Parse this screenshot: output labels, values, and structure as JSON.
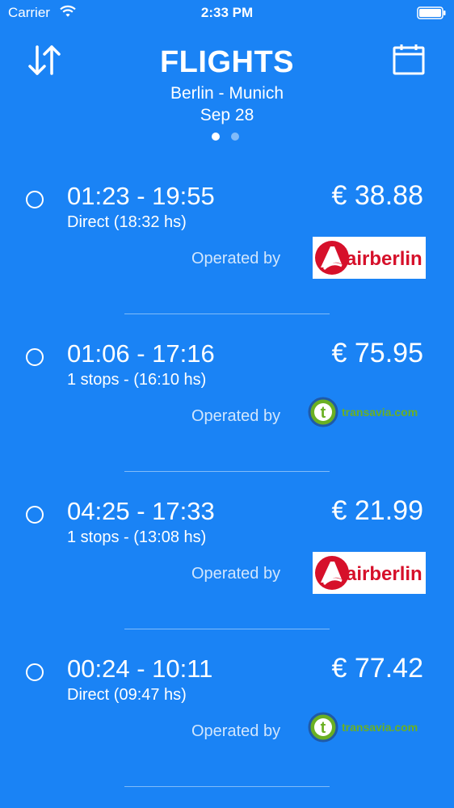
{
  "status_bar": {
    "carrier": "Carrier",
    "time": "2:33 PM"
  },
  "header": {
    "title": "FLIGHTS",
    "route": "Berlin - Munich",
    "date": "Sep 28"
  },
  "pager": {
    "pages": 2,
    "active": 0
  },
  "flights": [
    {
      "times": "01:23 - 19:55",
      "info": "Direct (18:32 hs)",
      "price": "€ 38.88",
      "operated_label": "Operated by",
      "airline": "airberlin"
    },
    {
      "times": "01:06 - 17:16",
      "info": "1 stops - (16:10 hs)",
      "price": "€ 75.95",
      "operated_label": "Operated by",
      "airline": "transavia.com"
    },
    {
      "times": "04:25 - 17:33",
      "info": "1 stops - (13:08 hs)",
      "price": "€ 21.99",
      "operated_label": "Operated by",
      "airline": "airberlin"
    },
    {
      "times": "00:24 - 10:11",
      "info": "Direct (09:47 hs)",
      "price": "€ 77.42",
      "operated_label": "Operated by",
      "airline": "transavia.com"
    }
  ],
  "colors": {
    "background": "#1a83f5",
    "airberlin_red": "#d6102a",
    "transavia_green": "#6ab023"
  }
}
